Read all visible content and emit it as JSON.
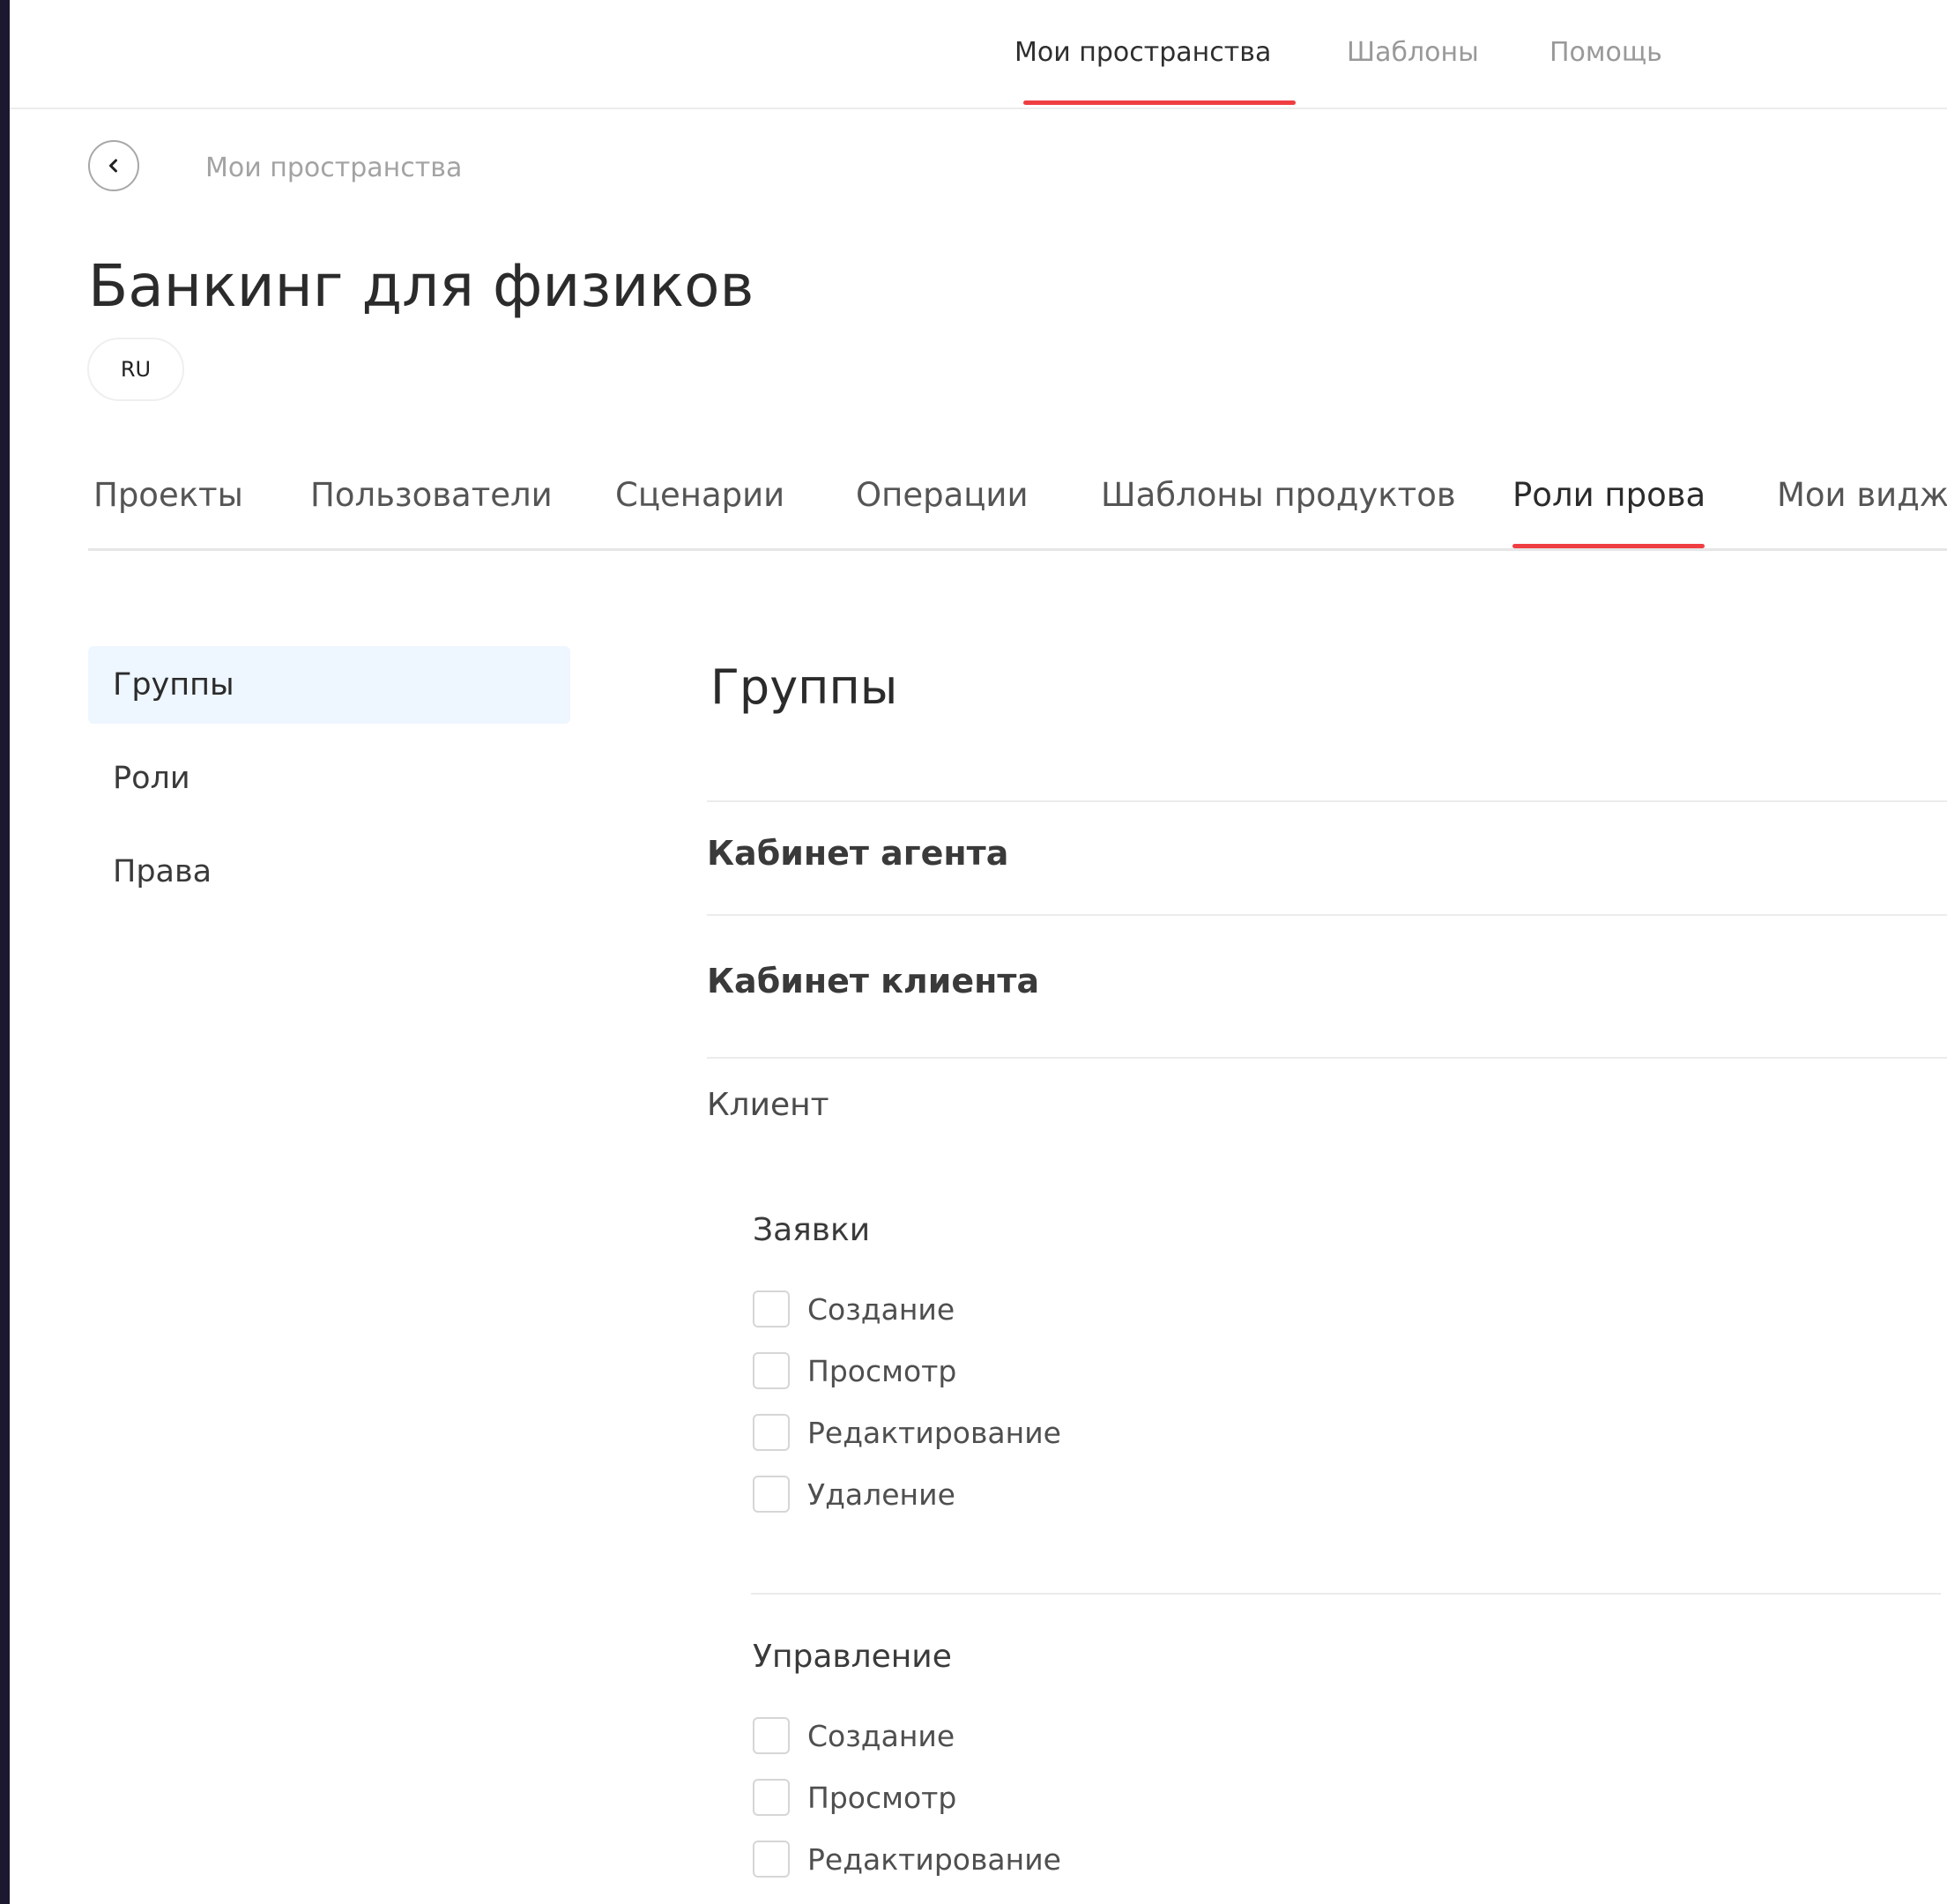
{
  "top_nav": {
    "tabs": [
      "Мои пространства",
      "Шаблоны",
      "Помощь"
    ]
  },
  "breadcrumb": {
    "label": "Мои пространства"
  },
  "page": {
    "title": "Банкинг для физиков",
    "language": "RU"
  },
  "tabs": [
    "Проекты",
    "Пользователи",
    "Сценарии",
    "Операции",
    "Шаблоны продуктов",
    "Роли прова",
    "Мои видж"
  ],
  "sidebar": {
    "items": [
      "Группы",
      "Роли",
      "Права"
    ]
  },
  "main": {
    "title": "Группы",
    "groups": [
      "Кабинет агента",
      "Кабинет клиента"
    ],
    "role": "Клиент",
    "categories": [
      {
        "title": "Заявки",
        "permissions": [
          "Создание",
          "Просмотр",
          "Редактирование",
          "Удаление"
        ]
      },
      {
        "title": "Управление",
        "permissions": [
          "Создание",
          "Просмотр",
          "Редактирование"
        ]
      }
    ]
  }
}
